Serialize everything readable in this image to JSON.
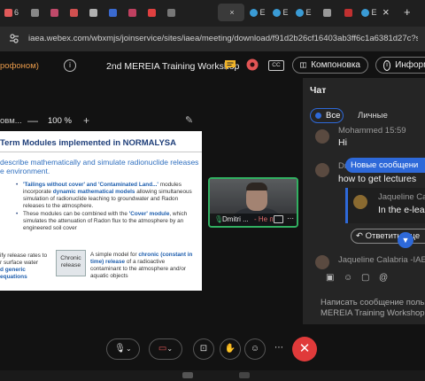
{
  "browser": {
    "tabs": [
      {
        "fav_color": "#e05a5a",
        "text": "6"
      },
      {
        "fav_color": "#888888",
        "text": ""
      },
      {
        "fav_color": "#c04a6a",
        "text": ""
      },
      {
        "fav_color": "#d05050",
        "text": ""
      },
      {
        "fav_color": "#b0b0b0",
        "text": ""
      },
      {
        "fav_color": "#3a6ad0",
        "text": ""
      },
      {
        "fav_color": "#c04060",
        "text": ""
      },
      {
        "fav_color": "#e04040",
        "text": "2"
      },
      {
        "fav_color": "#777777",
        "text": ""
      },
      {
        "fav_color": "#3a9bd5",
        "text": "E"
      },
      {
        "fav_color": "#3a9bd5",
        "text": "E"
      },
      {
        "fav_color": "#3a9bd5",
        "text": "E"
      },
      {
        "fav_color": "#999999",
        "text": ""
      },
      {
        "fav_color": "#c03030",
        "text": ""
      },
      {
        "fav_color": "#3a9bd5",
        "text": "E"
      }
    ],
    "active_close": "×",
    "new_tab": "+",
    "url": "iaea.webex.com/wbxmjs/joinservice/sites/iaea/meeting/download/f91d2b26cf16403ab3ff6c1a6381d27c?siteurl=iae..."
  },
  "meeting": {
    "mic_note": "рофоном)",
    "title": "2nd MEREIA Training Workshop",
    "cc": "CC",
    "layout_btn": "Компоновка",
    "info_btn": "Информ"
  },
  "share": {
    "label": "овм...",
    "zoom_minus": "—",
    "zoom": "100 %",
    "zoom_plus": "+"
  },
  "slide": {
    "title": "Term Modules implemented in NORMALYSA",
    "subtitle_1": "describe mathematically and simulate radionuclide releases",
    "subtitle_2": "e environment.",
    "b1_a": "'Tailings without cover' and 'Contaminated Land...'",
    "b1_b": " modules incorporate ",
    "b1_c": "dynamic mathematical models",
    "b1_d": " allowing simultaneous simulation of radionuclide leaching to groundwater and Radon releases to the atmosphere.",
    "b2_a": "These modules  can be combined with the ",
    "b2_b": "'Cover' module",
    "b2_c": ", which simulates the attenuation of Radon flux to the atmosphere by an engineered soil cover",
    "left_1": "ify release rates to",
    "left_2": "r surface water",
    "left_3": "d generic",
    "left_4": "equations",
    "chronic_1": "Chronic",
    "chronic_2": "release",
    "right_a": "A simple model for ",
    "right_b": "chronic (constant in time) release",
    "right_c": " of a radioactive contaminant to the atmosphere and/or aquatic objects"
  },
  "participant": {
    "name": "Dmitri ...",
    "status": "- He п"
  },
  "chat": {
    "title": "Чат",
    "tab_all": "Все",
    "tab_private": "Личные",
    "m1_name": "Mohammed  15:59",
    "m1_text": "Hi",
    "m2_name": "Dr. Za",
    "new_messages": "Новые сообщени",
    "m2_text": "how to get lectures",
    "reply_name": "Jaqueline Calab",
    "reply_text": "In the e-lear",
    "reply_button": "Ответить в це",
    "m3_name": "Jaqueline Calabria -IAEA",
    "compose_placeholder_1": "Написать сообщение пользов",
    "compose_placeholder_2": "MEREIA Training Workshop"
  }
}
